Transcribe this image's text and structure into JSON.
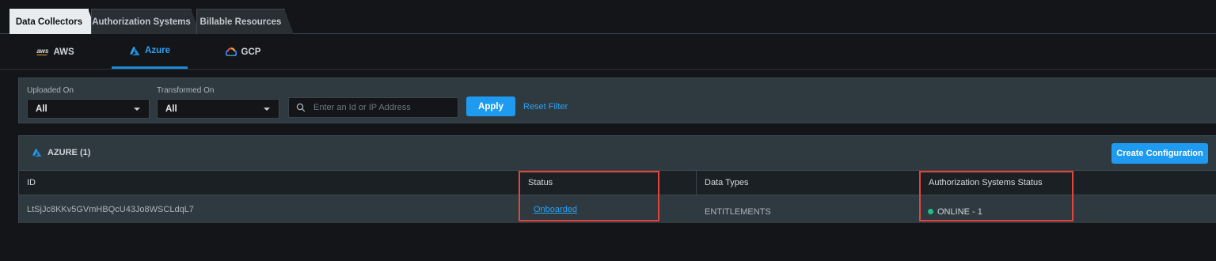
{
  "top_tabs": [
    "Data Collectors",
    "Authorization Systems",
    "Billable Resources"
  ],
  "provider_tabs": [
    {
      "label": "AWS",
      "icon": "aws-logo-icon",
      "active": false
    },
    {
      "label": "Azure",
      "icon": "azure-logo-icon",
      "active": true
    },
    {
      "label": "GCP",
      "icon": "gcp-logo-icon",
      "active": false
    }
  ],
  "filters": {
    "uploaded_label": "Uploaded On",
    "uploaded_value": "All",
    "transformed_label": "Transformed On",
    "transformed_value": "All",
    "search_placeholder": "Enter an Id or IP Address",
    "apply_label": "Apply",
    "reset_label": "Reset Filter"
  },
  "section": {
    "title": "AZURE (1)",
    "create_label": "Create Configuration",
    "columns": [
      "ID",
      "Status",
      "Data Types",
      "Authorization Systems Status"
    ],
    "rows": [
      {
        "id": "LtSjJc8KKv5GVmHBQcU43Jo8WSCLdqL7",
        "status": "Onboarded",
        "data_types": "ENTITLEMENTS",
        "auth_status": "ONLINE - 1"
      }
    ]
  },
  "colors": {
    "accent": "#1e9bf0",
    "online": "#1fc08a",
    "highlight": "#e2453c"
  }
}
